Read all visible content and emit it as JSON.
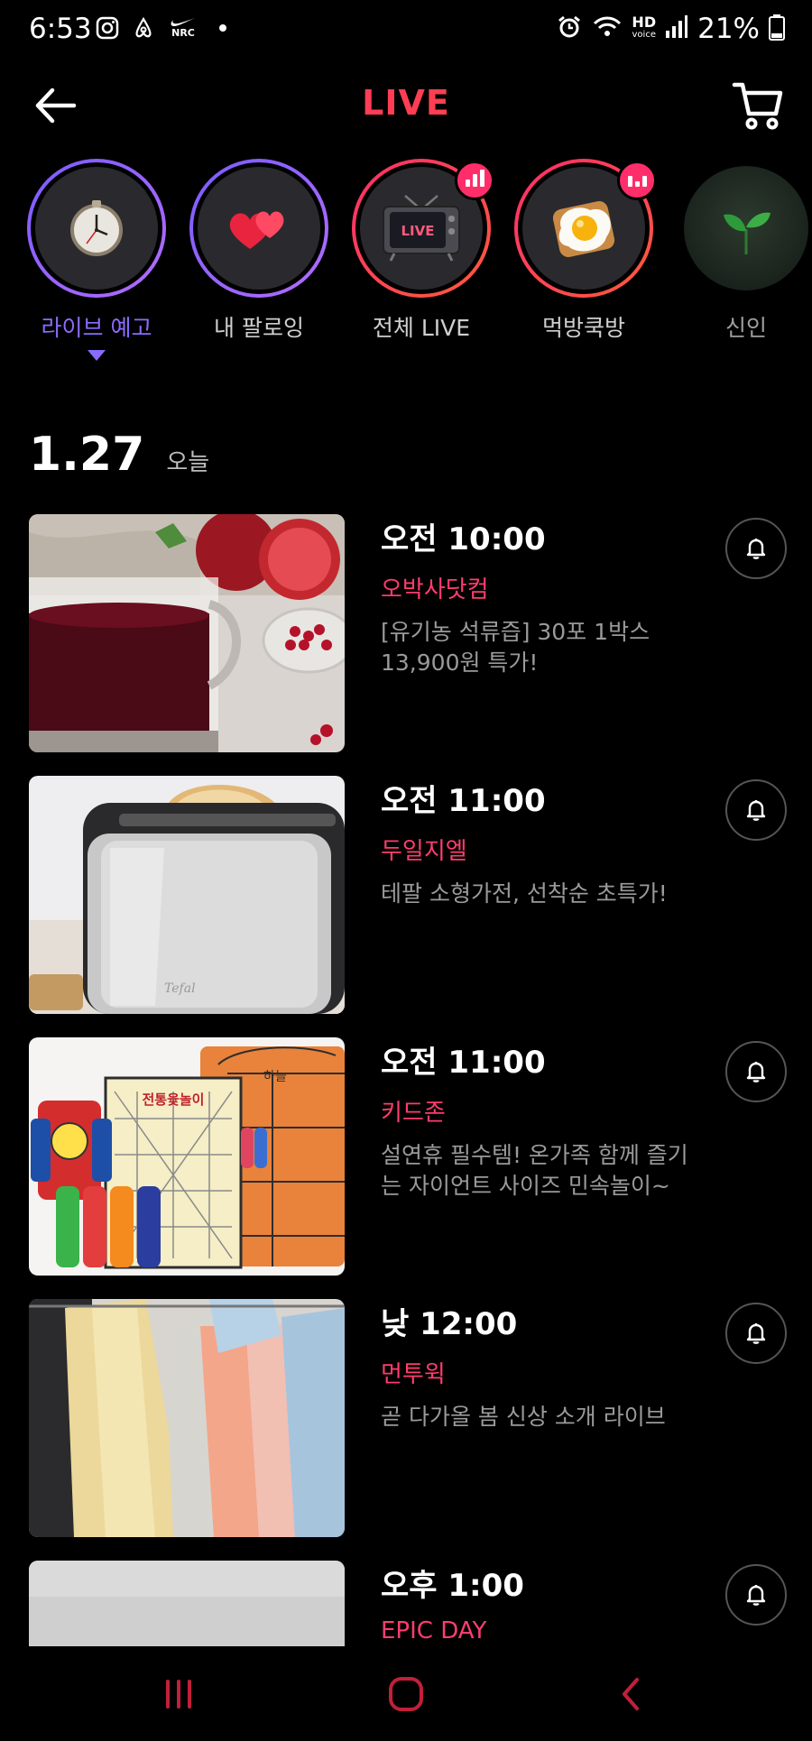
{
  "status_bar": {
    "time": "6:53",
    "left_icons": [
      "instagram-icon",
      "airbnb-icon",
      "nike-run-club-icon",
      "dot-icon"
    ],
    "nrc_text": "NRC",
    "right_icons": [
      "alarm-icon",
      "wifi-icon",
      "hd-voice-icon",
      "signal-icon",
      "battery-icon"
    ],
    "hd_text": "HD",
    "voice_text": "voice",
    "battery_percent": "21%"
  },
  "header": {
    "title": "LIVE",
    "back_icon": "back-arrow-icon",
    "cart_icon": "cart-icon"
  },
  "categories": [
    {
      "label": "라이브 예고",
      "icon": "clock-icon",
      "active": true,
      "ring": "purple",
      "live": false
    },
    {
      "label": "내 팔로잉",
      "icon": "hearts-icon",
      "active": false,
      "ring": "purple",
      "live": false
    },
    {
      "label": "전체 LIVE",
      "icon": "tv-live-icon",
      "active": false,
      "ring": "red",
      "live": true,
      "tv_text": "LIVE"
    },
    {
      "label": "먹방쿡방",
      "icon": "fried-egg-icon",
      "active": false,
      "ring": "red",
      "live": true
    },
    {
      "label": "신인",
      "icon": "sprout-icon",
      "active": false,
      "ring": "none",
      "live": false
    }
  ],
  "date": {
    "day": "1.27",
    "label": "오늘"
  },
  "schedule": [
    {
      "time": "오전 10:00",
      "seller": "오박사닷컴",
      "desc": "[유기농 석류즙] 30포 1박스 13,900원 특가!",
      "thumb": "pomegranate-juice"
    },
    {
      "time": "오전 11:00",
      "seller": "두일지엘",
      "desc": "테팔 소형가전, 선착순 초특가!",
      "thumb": "toaster",
      "brand_text": "Tefal"
    },
    {
      "time": "오전 11:00",
      "seller": "키드존",
      "desc": "설연휴 필수템! 온가족 함께 즐기는 자이언트 사이즈 민속놀이~",
      "thumb": "folk-games",
      "board_title": "전통윷놀이",
      "sky_text": "하늘"
    },
    {
      "time": "낮 12:00",
      "seller": "먼투윅",
      "desc": "곧 다가올 봄 신상 소개 라이브",
      "thumb": "clothes-rack"
    },
    {
      "time": "오후 1:00",
      "seller": "EPIC DAY",
      "desc": "",
      "thumb": "gray-cloth"
    }
  ],
  "colors": {
    "accent_pink": "#ff3d6e",
    "active_purple": "#8a6bff",
    "background": "#000000"
  },
  "nav_bar": {
    "icons": [
      "recent-apps-icon",
      "home-icon",
      "back-icon"
    ]
  }
}
